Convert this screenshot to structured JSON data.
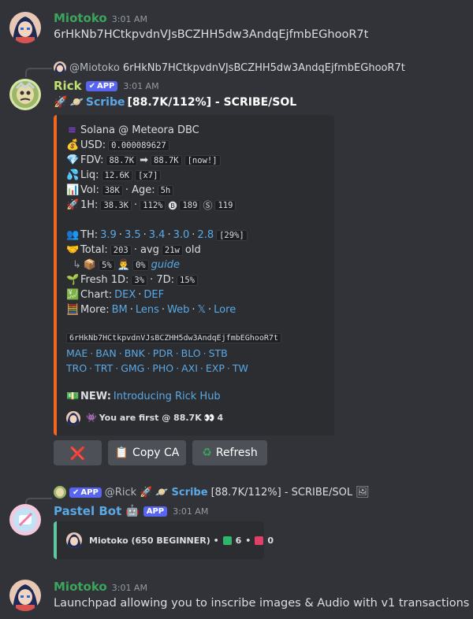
{
  "messages": [
    {
      "author": "Miotoko",
      "time": "3:01 AM",
      "text": "6rHkNb7HCtkpvdnVJsBCZHH5dw3AndqEjfmbEGhooR7t"
    },
    {
      "author": "Miotoko",
      "time": "3:01 AM",
      "text": "Launchpad allowing you to inscribe images & Audio with v1 transactions"
    }
  ],
  "rick_reply": {
    "mention": "@Miotoko",
    "text": "6rHkNb7HCtkpvdnVJsBCZHH5dw3AndqEjfmbEGhooR7t"
  },
  "rick": {
    "author": "Rick",
    "badge": "APP",
    "time": "3:01 AM",
    "title_link": "Scribe",
    "title_rest": "[88.7K/112%] - SCRIBE/SOL",
    "embed": {
      "chain": "Solana @ Meteora DBC",
      "usd_label": "USD:",
      "usd_value": "0.000089627",
      "fdv_label": "FDV:",
      "fdv_from": "88.7K",
      "fdv_to": "88.7K",
      "fdv_now": "[now!]",
      "liq_label": "Liq:",
      "liq_value": "12.6K",
      "liq_mult": "[x7]",
      "vol_label": "Vol:",
      "vol_value": "38K",
      "age_label": "· Age:",
      "age_value": "5h",
      "h1_label": "1H:",
      "h1_value": "38.3K",
      "h1_pct": "112%",
      "buys": "189",
      "sells": "119",
      "th_label": "TH:",
      "th_values": [
        "3.9",
        "3.5",
        "3.4",
        "3.0",
        "2.8"
      ],
      "th_total": "[29%]",
      "total_label": "Total:",
      "total_value": "203",
      "avg_label": "· avg",
      "avg_value": "21w",
      "old_label": "old",
      "sub_pct1": "5%",
      "sub_pct2": "0%",
      "guide": "guide",
      "fresh_label": "Fresh 1D:",
      "fresh_1d": "3%",
      "fresh_7d_label": "· 7D:",
      "fresh_7d": "15%",
      "chart_label": "Chart:",
      "chart_links": [
        "DEX",
        "DEF"
      ],
      "more_label": "More:",
      "more_links": [
        "BM",
        "Lens",
        "Web",
        "𝕏",
        "Lore"
      ],
      "ca": "6rHkNb7HCtkpvdnVJsBCZHH5dw3AndqEjfmbEGhooR7t",
      "bots_line1": [
        "MAE",
        "BAN",
        "BNK",
        "PDR",
        "BLO",
        "STB"
      ],
      "bots_line2": [
        "TRO",
        "TRT",
        "GMG",
        "PHO",
        "AXI",
        "EXP",
        "TW"
      ],
      "new_label": "NEW:",
      "new_link": "Introducing Rick Hub",
      "first_text": "You are first @ 88.7K",
      "first_count": "4"
    },
    "buttons": {
      "close": "❌",
      "copy": "Copy CA",
      "refresh": "Refresh"
    }
  },
  "pastel_reply": {
    "badge": "APP",
    "mention": "@Rick",
    "link": "Scribe",
    "rest": "[88.7K/112%] - SCRIBE/SOL"
  },
  "pastel": {
    "author": "Pastel Bot",
    "badge": "APP",
    "time": "3:01 AM",
    "embed_text": "Miotoko (650 BEGINNER) •",
    "green_count": "6",
    "red_count": "0"
  },
  "colors": {
    "accent": "#5865f2",
    "rick_name": "#c0e070",
    "miotoko_name": "#3ba55c",
    "pastel_name": "#5aa9e6",
    "embed_bar": "#f26522",
    "link": "#5aa9e6"
  },
  "icons": [
    "rocket-icon",
    "planet-icon",
    "solana-icon",
    "money-bag-icon",
    "gem-icon",
    "droplets-icon",
    "bar-chart-icon",
    "busts-icon",
    "handshake-icon",
    "package-icon",
    "office-worker-icon",
    "seedling-icon",
    "yen-chart-icon",
    "abacus-icon",
    "dollar-card-icon",
    "eyes-icon",
    "robot-icon",
    "image-icon",
    "recycle-icon",
    "clipboard-icon"
  ]
}
